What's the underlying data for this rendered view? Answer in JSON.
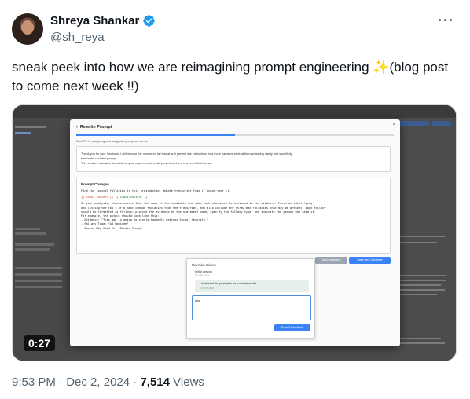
{
  "author": {
    "name": "Shreya Shankar",
    "handle": "@sh_reya"
  },
  "tweet": {
    "text_part1": "sneak peek into how we are reimagining prompt engineering ",
    "sparkle": "✨",
    "text_part2": "(blog post to come next week !!)"
  },
  "video": {
    "duration": "0:27",
    "modal": {
      "title": "Rewrite Prompt",
      "close": "×",
      "progress_fraction": 0.5,
      "subtitle": "DocETL is analyzing and suggesting improvements",
      "intro_lines": [
        "Thank you for your feedback. I will remove the numbered list format and present the instructions in a more narrative style while maintaining clarity and specificity.",
        "Here's the updated prompt:",
        "This version maintains the clarity of your requirements while presenting them in a more fluid format."
      ],
      "changes_title": "Prompt Changes",
      "prompt_line1": "Find the logical fallacies in this presidential debate transcript from {{ input.year }}.",
      "prompt_line2_removed": "{{ input.content }}",
      "prompt_line2_added": "{{ input.content }}",
      "prompt_body": "In your analysis, please ensure that the name of the candidate who made each statement is included in the evidence. Focus on identifying\nand listing the top 5 or 6 most common fallacies from the transcript, and also include any straw man fallacies that may be present. Each fallacy\nshould be formatted as follows: provide the evidence as the statement made, specify the fallacy type, and indicate the person who said it.\nFor example, the output should look like this:\n- Evidence: \"This man is going to single-handedly destroy Social Security.\"\n- Fallacy Type: \"Ad Hominem\"\n- Person Who Said It: \"Donald Trump\"",
      "add_feedback_label": "Add feedback",
      "save_continue_label": "Save and Continue"
    },
    "revision": {
      "title": "Revision History",
      "initial_version": "Initial version",
      "initial_time": "10:19:16 AM",
      "note_text": "I dont want the prompt to be a numbered list",
      "note_time": "10:19:20 AM",
      "input_value": "yes|",
      "submit_label": "Submit Feedback"
    }
  },
  "meta": {
    "time": "9:53 PM",
    "separator1": " · ",
    "date": "Dec 2, 2024",
    "separator2": " · ",
    "views_count": "7,514",
    "views_label": " Views"
  },
  "icons": {
    "verified": "verified-badge-icon",
    "more": "more-options-icon"
  },
  "colors": {
    "accent": "#1d9bf0",
    "secondary_text": "#536471"
  }
}
